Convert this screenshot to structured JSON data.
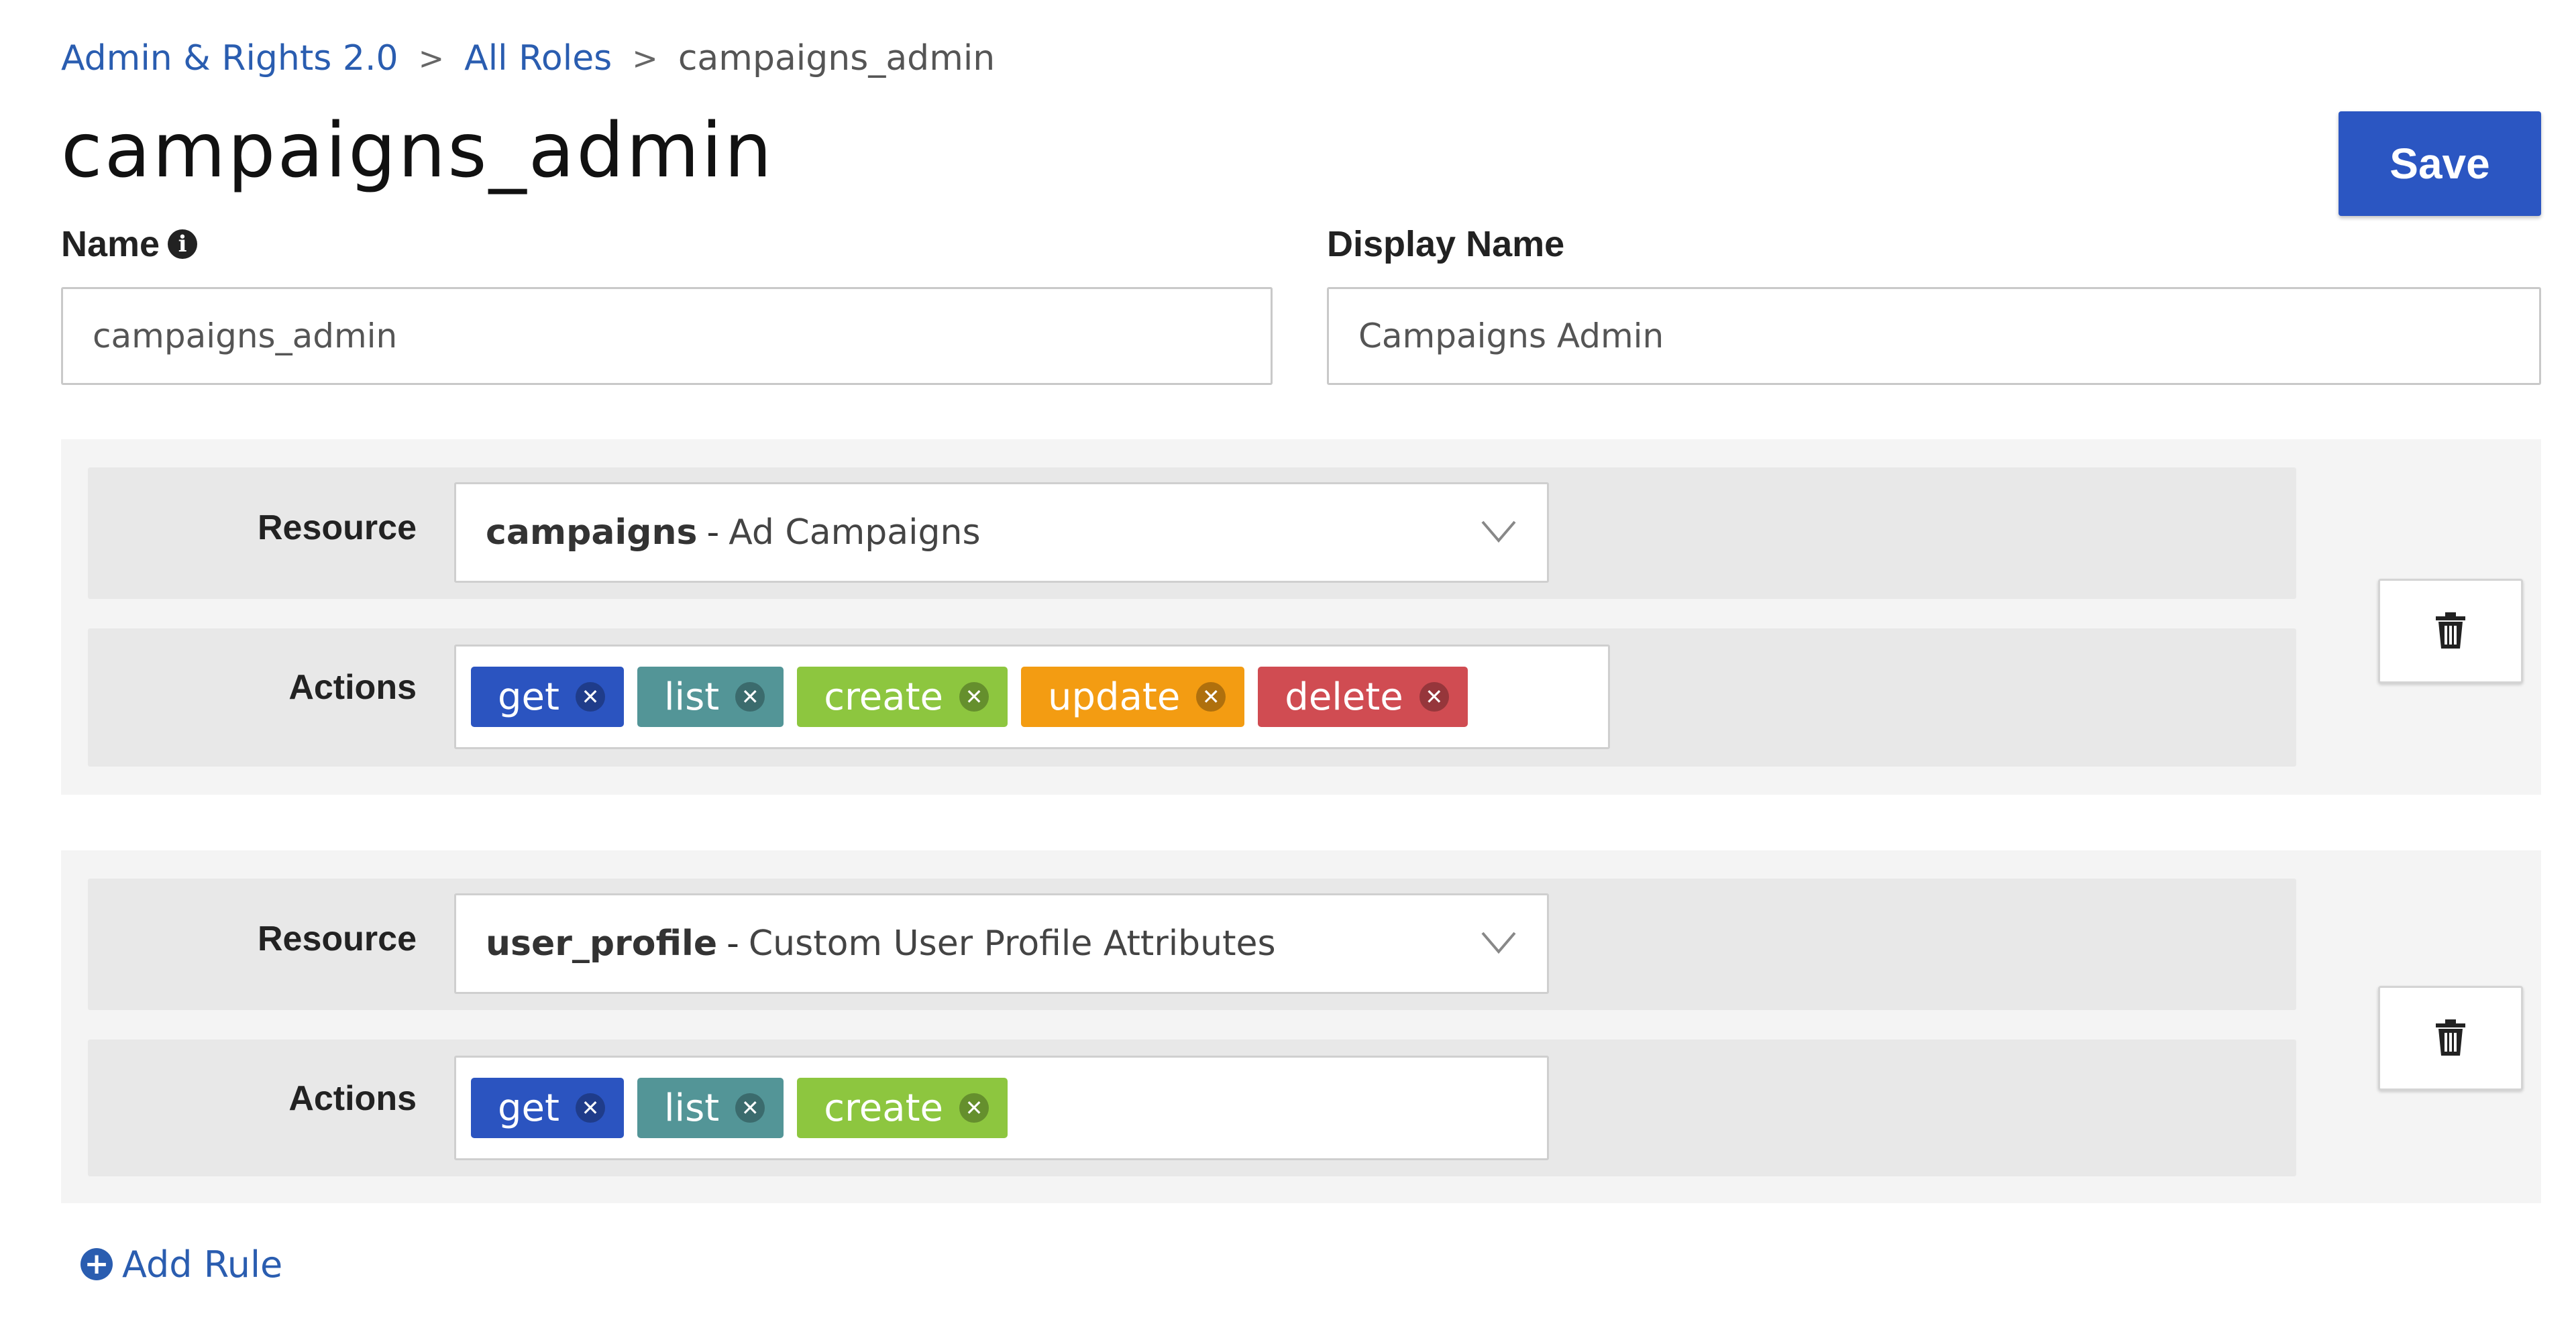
{
  "breadcrumb": {
    "items": [
      {
        "label": "Admin & Rights 2.0"
      },
      {
        "label": "All Roles"
      },
      {
        "label": "campaigns_admin"
      }
    ],
    "separator": ">"
  },
  "page": {
    "title": "campaigns_admin",
    "save_label": "Save"
  },
  "form": {
    "name_label": "Name",
    "name_value": "campaigns_admin",
    "display_name_label": "Display Name",
    "display_name_value": "Campaigns Admin"
  },
  "rules": [
    {
      "resource_label": "Resource",
      "resource_id": "campaigns",
      "resource_separator": "-",
      "resource_desc": "Ad Campaigns",
      "actions_label": "Actions",
      "actions": [
        {
          "label": "get",
          "color": "#2b54c0"
        },
        {
          "label": "list",
          "color": "#539597"
        },
        {
          "label": "create",
          "color": "#8dc63f"
        },
        {
          "label": "update",
          "color": "#f39c12"
        },
        {
          "label": "delete",
          "color": "#d04c52"
        }
      ]
    },
    {
      "resource_label": "Resource",
      "resource_id": "user_profile",
      "resource_separator": "-",
      "resource_desc": "Custom User Profile Attributes",
      "actions_label": "Actions",
      "actions": [
        {
          "label": "get",
          "color": "#2b54c0"
        },
        {
          "label": "list",
          "color": "#539597"
        },
        {
          "label": "create",
          "color": "#8dc63f"
        }
      ]
    }
  ],
  "add_rule_label": "Add Rule",
  "icons": {
    "info": "info-icon",
    "chevron": "chevron-down-icon",
    "trash": "trash-icon",
    "tag_remove": "close-icon",
    "add": "plus-circle-icon"
  }
}
